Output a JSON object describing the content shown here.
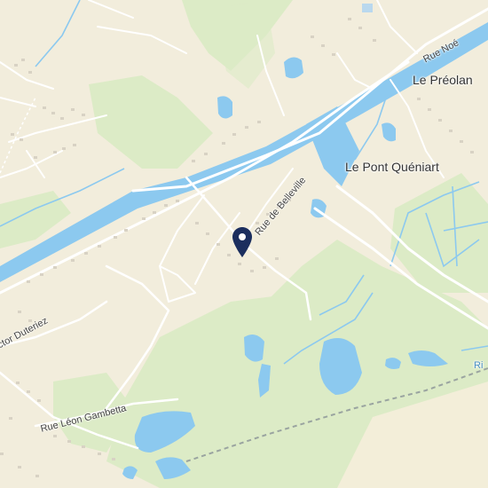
{
  "colors": {
    "land": "#f2eddc",
    "park": "#dcebc6",
    "water": "#8cc9ef",
    "road": "#ffffff",
    "marker": "#1b2e5e"
  },
  "labels": {
    "le_preolan": "Le Préolan",
    "le_pont_queniart": "Le Pont Quéniart",
    "rue_noe": "Rue Noé",
    "rue_de_belleville": "Rue de Belleville",
    "rue_leon_gambetta": "Rue Léon Gambetta",
    "victor_duteriez": "ctor Duteriez",
    "river_fragment": "Ri"
  },
  "marker": {
    "icon": "location-pin-icon"
  }
}
